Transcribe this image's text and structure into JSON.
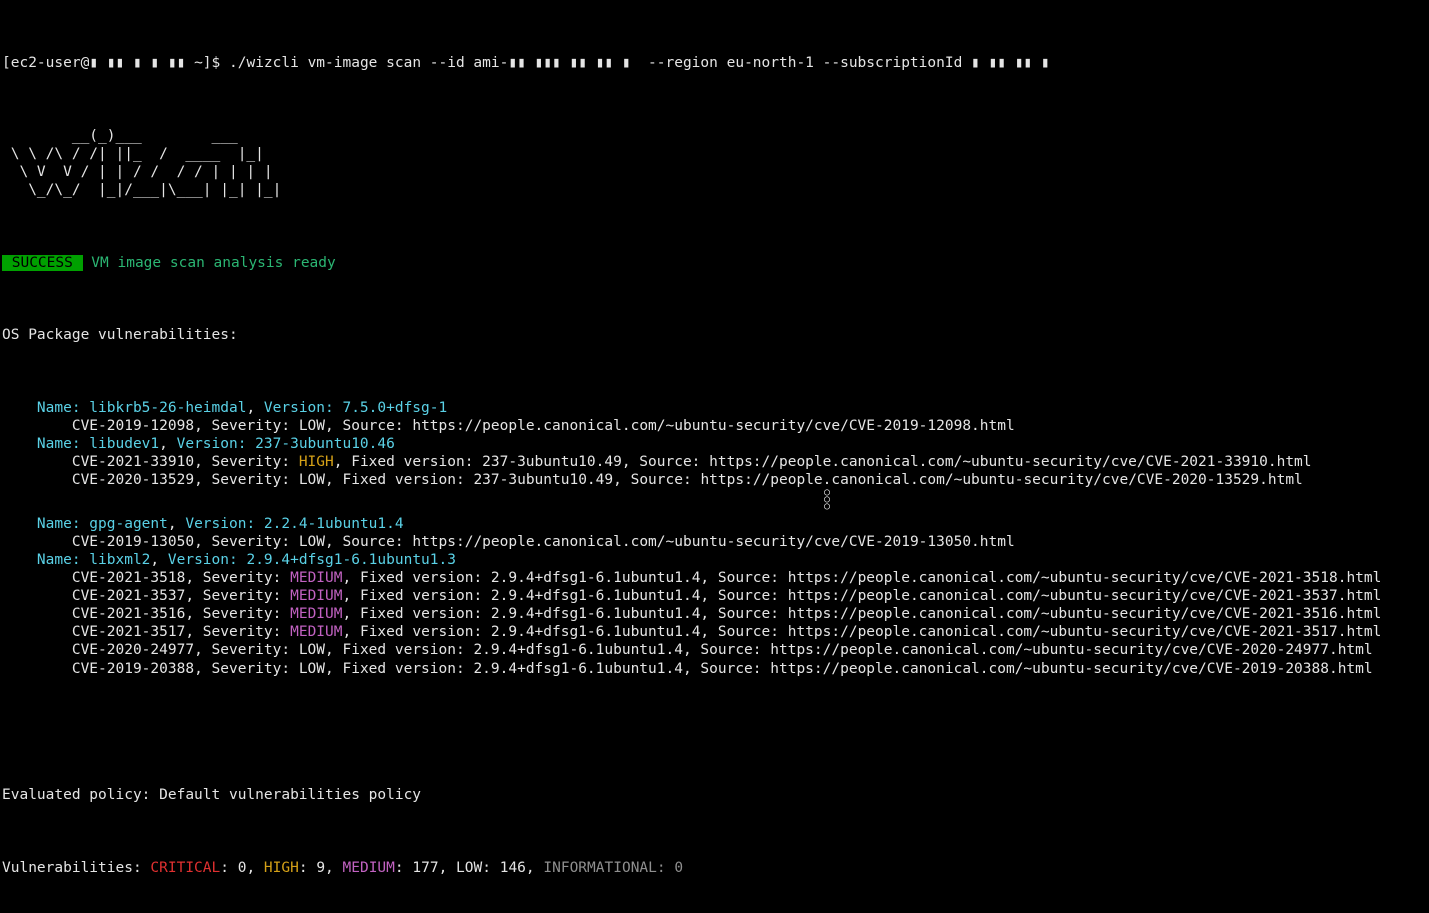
{
  "prompt": {
    "user_host": "[ec2-user@",
    "redacted_host": "▮ ▮▮ ▮ ▮ ▮▮",
    "path_end": " ~]$ ",
    "command_prefix": "./wizcli vm-image scan --id ami-",
    "redacted_ami": "▮▮ ▮▮▮ ▮▮ ▮▮ ▮",
    "command_mid": "  --region eu-north-1 --subscriptionId ",
    "redacted_sub": "▮ ▮▮ ▮▮ ▮"
  },
  "ascii_art": "        __(_)___        ___  \n \\ \\ /\\ / /| ||_  /  ____  |_|  \n  \\ V  V / | | / /  / / | | | |  \n   \\_/\\_/  |_|/___|\\___| |_| |_|",
  "status": {
    "badge": " SUCCESS ",
    "message": " VM image scan analysis ready"
  },
  "section_header": "OS Package vulnerabilities:",
  "packages": [
    {
      "name": "libkrb5-26-heimdal",
      "version": "7.5.0+dfsg-1",
      "cves": [
        {
          "id": "CVE-2019-12098",
          "severity": "LOW",
          "fixed": null,
          "source": "https://people.canonical.com/~ubuntu-security/cve/CVE-2019-12098.html"
        }
      ]
    },
    {
      "name": "libudev1",
      "version": "237-3ubuntu10.46",
      "cves": [
        {
          "id": "CVE-2021-33910",
          "severity": "HIGH",
          "fixed": "237-3ubuntu10.49",
          "source": "https://people.canonical.com/~ubuntu-security/cve/CVE-2021-33910.html"
        },
        {
          "id": "CVE-2020-13529",
          "severity": "LOW",
          "fixed": "237-3ubuntu10.49",
          "source": "https://people.canonical.com/~ubuntu-security/cve/CVE-2020-13529.html"
        }
      ]
    },
    {
      "name": "gpg-agent",
      "version": "2.2.4-1ubuntu1.4",
      "cves": [
        {
          "id": "CVE-2019-13050",
          "severity": "LOW",
          "fixed": null,
          "source": "https://people.canonical.com/~ubuntu-security/cve/CVE-2019-13050.html"
        }
      ]
    },
    {
      "name": "libxml2",
      "version": "2.9.4+dfsg1-6.1ubuntu1.3",
      "cves": [
        {
          "id": "CVE-2021-3518",
          "severity": "MEDIUM",
          "fixed": "2.9.4+dfsg1-6.1ubuntu1.4",
          "source": "https://people.canonical.com/~ubuntu-security/cve/CVE-2021-3518.html"
        },
        {
          "id": "CVE-2021-3537",
          "severity": "MEDIUM",
          "fixed": "2.9.4+dfsg1-6.1ubuntu1.4",
          "source": "https://people.canonical.com/~ubuntu-security/cve/CVE-2021-3537.html"
        },
        {
          "id": "CVE-2021-3516",
          "severity": "MEDIUM",
          "fixed": "2.9.4+dfsg1-6.1ubuntu1.4",
          "source": "https://people.canonical.com/~ubuntu-security/cve/CVE-2021-3516.html"
        },
        {
          "id": "CVE-2021-3517",
          "severity": "MEDIUM",
          "fixed": "2.9.4+dfsg1-6.1ubuntu1.4",
          "source": "https://people.canonical.com/~ubuntu-security/cve/CVE-2021-3517.html"
        },
        {
          "id": "CVE-2020-24977",
          "severity": "LOW",
          "fixed": "2.9.4+dfsg1-6.1ubuntu1.4",
          "source": "https://people.canonical.com/~ubuntu-security/cve/CVE-2020-24977.html"
        },
        {
          "id": "CVE-2019-20388",
          "severity": "LOW",
          "fixed": "2.9.4+dfsg1-6.1ubuntu1.4",
          "source": "https://people.canonical.com/~ubuntu-security/cve/CVE-2019-20388.html"
        }
      ]
    }
  ],
  "ellipsis_after_package_index": 1,
  "policy_line": "Evaluated policy: Default vulnerabilities policy",
  "summary": {
    "label": "Vulnerabilities: ",
    "critical_label": "CRITICAL",
    "critical": 0,
    "high_label": "HIGH",
    "high": 9,
    "medium_label": "MEDIUM",
    "medium": 177,
    "low_label": "LOW",
    "low": 146,
    "info_label": "INFORMATIONAL",
    "info": 0
  }
}
